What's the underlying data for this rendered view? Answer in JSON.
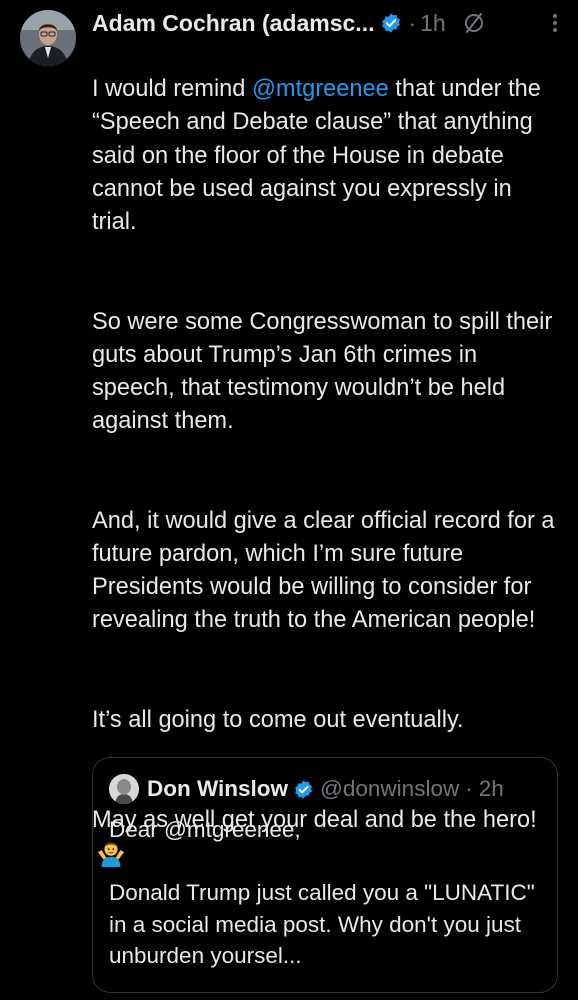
{
  "tweet": {
    "author_name": "Adam Cochran (adamsc...",
    "separator": "·",
    "time": "1h",
    "text_intro_prefix": "I would remind ",
    "mention": "@mtgreenee",
    "text_intro_suffix": " that under the “Speech and Debate clause” that anything said on the floor of the House in debate cannot be used against you expressly in trial.",
    "paragraphs": [
      "So were some Congresswoman to spill their guts about Trump’s Jan 6th crimes in speech, that testimony wouldn’t be held against them.",
      "And, it would give a clear official record for a future pardon, which I’m sure future Presidents would be willing to consider for revealing the truth to the American people!",
      "It’s all going to come out eventually."
    ],
    "final_paragraph": "May as well get your deal and be the hero!",
    "icons": {
      "verified": "verified-badge-icon",
      "grok": "grok-icon",
      "more": "more-options-icon",
      "emoji": "person-shrugging-emoji"
    },
    "colors": {
      "background": "#000000",
      "text": "#e7e9ea",
      "muted": "#71767b",
      "link": "#1d9bf0",
      "verified": "#1d9bf0",
      "border": "#2f3336"
    }
  },
  "quote": {
    "author_name": "Don Winslow",
    "handle": "@donwinslow",
    "separator": "·",
    "time": "2h",
    "paragraphs": [
      "Dear @mtgreenee,",
      "Donald Trump just called you a \"LUNATIC\" in a social media post. Why don't you just unburden yoursel..."
    ]
  }
}
